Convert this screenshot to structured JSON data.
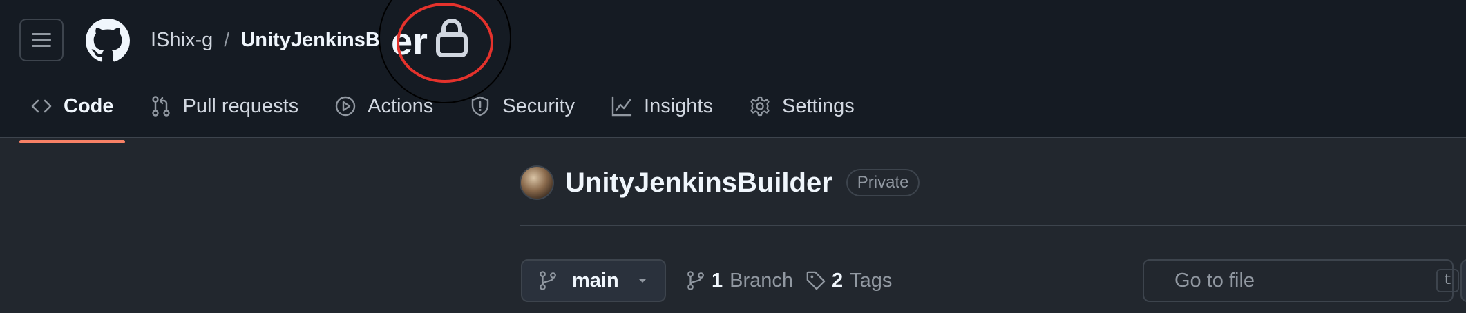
{
  "header": {
    "owner": "IShix-g",
    "separator": "/",
    "repo": "UnityJenkinsBu",
    "magnifier_text": "er"
  },
  "tabs": [
    {
      "label": "Code",
      "icon": "code-icon",
      "active": true
    },
    {
      "label": "Pull requests",
      "icon": "git-pull-request-icon",
      "active": false
    },
    {
      "label": "Actions",
      "icon": "play-icon",
      "active": false
    },
    {
      "label": "Security",
      "icon": "shield-icon",
      "active": false
    },
    {
      "label": "Insights",
      "icon": "graph-icon",
      "active": false
    },
    {
      "label": "Settings",
      "icon": "gear-icon",
      "active": false
    }
  ],
  "repo": {
    "name": "UnityJenkinsBuilder",
    "visibility": "Private"
  },
  "branch": {
    "current": "main",
    "branch_count": "1",
    "branch_label": "Branch",
    "tag_count": "2",
    "tag_label": "Tags"
  },
  "search": {
    "placeholder": "Go to file",
    "shortcut": "t"
  },
  "colors": {
    "header_bg": "#151b23",
    "page_bg": "#22272e",
    "border": "#3d444d",
    "active_underline": "#f78166",
    "annotation_ring": "#e5322c"
  }
}
